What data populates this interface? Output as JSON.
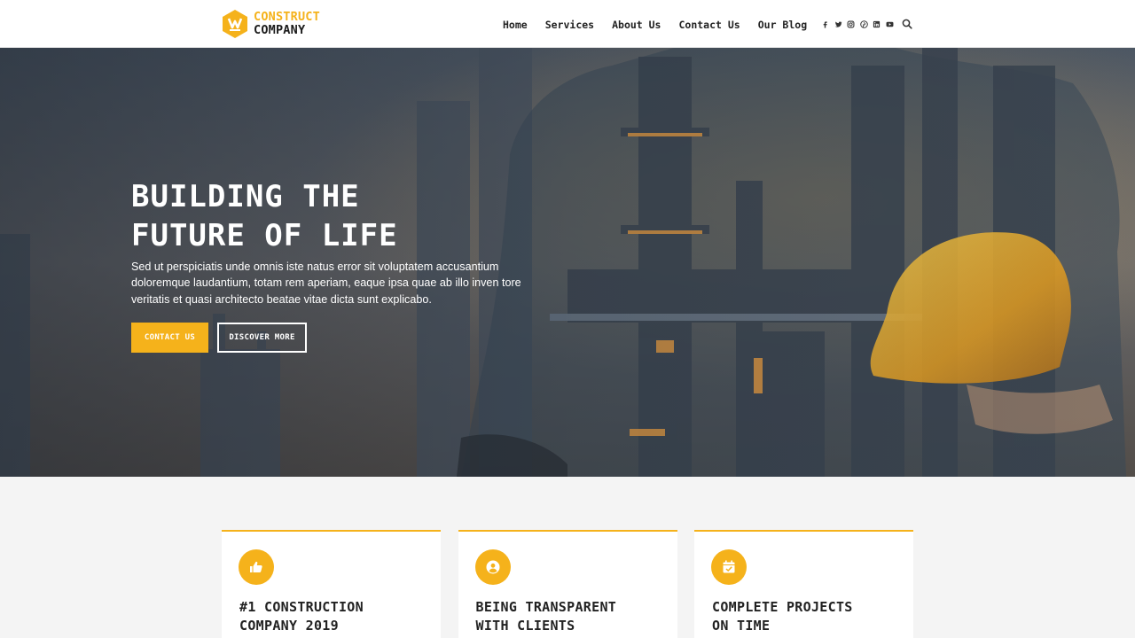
{
  "brand": {
    "line1": "CONSTRUCT",
    "line2": "COMPANY",
    "accent": "#f5b21b"
  },
  "nav": {
    "items": [
      "Home",
      "Services",
      "About Us",
      "Contact Us",
      "Our Blog"
    ]
  },
  "social": [
    "facebook-icon",
    "twitter-icon",
    "instagram-icon",
    "pinterest-icon",
    "linkedin-icon",
    "youtube-icon"
  ],
  "hero": {
    "title_line1": "BUILDING THE",
    "title_line2": "FUTURE OF LIFE",
    "text": "Sed ut perspiciatis unde omnis iste natus error sit voluptatem accusantium doloremque laudantium, totam rem aperiam, eaque ipsa quae ab illo inven tore veritatis et quasi architecto beatae vitae dicta sunt explicabo.",
    "btn_primary": "CONTACT US",
    "btn_secondary": "DISCOVER MORE"
  },
  "features": [
    {
      "icon": "thumbs-up-icon",
      "line1": "#1 CONSTRUCTION",
      "line2": "COMPANY 2019"
    },
    {
      "icon": "user-circle-icon",
      "line1": "BEING TRANSPARENT",
      "line2": "WITH CLIENTS"
    },
    {
      "icon": "calendar-check-icon",
      "line1": "COMPLETE PROJECTS",
      "line2": "ON TIME"
    }
  ]
}
